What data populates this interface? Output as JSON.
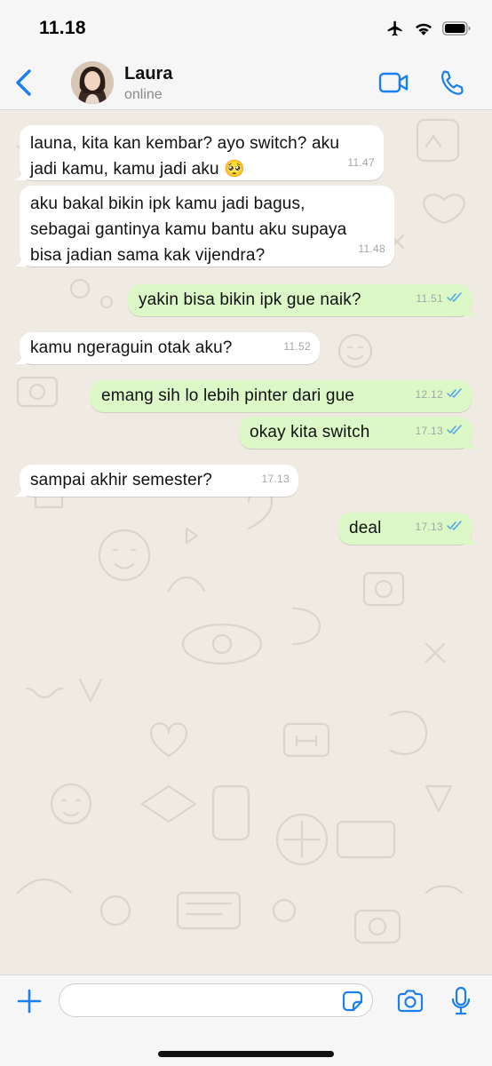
{
  "status_bar": {
    "time": "11.18",
    "icons": [
      "airplane-icon",
      "wifi-icon",
      "battery-icon"
    ]
  },
  "header": {
    "contact_name": "Laura",
    "contact_status": "online",
    "icons": [
      "back-chevron-icon",
      "video-call-icon",
      "phone-icon"
    ]
  },
  "colors": {
    "accent": "#1a7ff0",
    "incoming_bubble": "#ffffff",
    "outgoing_bubble": "#dbf8c6",
    "chat_background": "#efeae2",
    "read_ticks": "#4fa6e8"
  },
  "messages": [
    {
      "direction": "incoming",
      "text": "launa, kita kan kembar? ayo switch? aku\njadi kamu, kamu jadi aku 🥺",
      "time": "11.47"
    },
    {
      "direction": "incoming",
      "text": "aku bakal bikin ipk kamu jadi bagus,\nsebagai gantinya kamu bantu aku supaya\nbisa jadian sama kak vijendra?",
      "time": "11.48"
    },
    {
      "direction": "outgoing",
      "text": "yakin bisa bikin ipk gue naik?",
      "time": "11.51",
      "status": "read"
    },
    {
      "direction": "incoming",
      "text": "kamu ngeraguin otak aku?",
      "time": "11.52"
    },
    {
      "direction": "outgoing",
      "text": "emang sih lo lebih pinter dari gue",
      "time": "12.12",
      "status": "read"
    },
    {
      "direction": "outgoing",
      "text": "okay kita switch",
      "time": "17.13",
      "status": "read"
    },
    {
      "direction": "incoming",
      "text": "sampai akhir semester?",
      "time": "17.13"
    },
    {
      "direction": "outgoing",
      "text": "deal",
      "time": "17.13",
      "status": "read"
    }
  ],
  "composer": {
    "placeholder": "",
    "value": "",
    "icons": [
      "plus-icon",
      "sticker-icon",
      "camera-icon",
      "microphone-icon"
    ]
  }
}
